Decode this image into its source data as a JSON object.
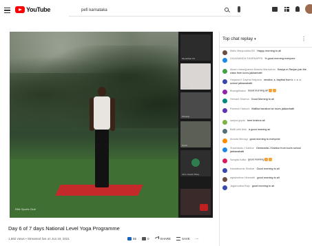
{
  "header": {
    "logo_text": "YouTube",
    "search_value": "pefi karnataka"
  },
  "video": {
    "speaker_name": "Elite Sports Club",
    "tiles": [
      "Muralidhar KS",
      "Nandini",
      "Shivaraj",
      "Mythri",
      "John Joseph Rhea",
      ""
    ]
  },
  "title": "Day 6 of 7 days National Level Yoga Programme",
  "meta": "1,682 views • Streamed live on Jun 19, 2021",
  "actions": {
    "likes": "55",
    "dislikes": "0",
    "share": "SHARE",
    "save": "SAVE",
    "more": "..."
  },
  "chat": {
    "header": "Top chat replay",
    "messages": [
      {
        "author": "Mallu Manjunatha BS",
        "text": "Happy morning to all",
        "color": "#6d4c41"
      },
      {
        "author": "GAJANANDA SHARNAPPA",
        "text": "% good morning everyone",
        "color": "#1e88e5"
      },
      {
        "author": "Akash maranjpanse Akasha Marewiran",
        "text": "Kaviya m Ranjan join the class from kcvrs jakkanhatti",
        "color": "#43a047"
      },
      {
        "author": "Halpana K Dayhal Halpana",
        "text": "nendha. s. baythal from k. r. c. c. school jakkanahatti",
        "color": "#3949ab"
      },
      {
        "author": "Bhangithlakoi",
        "text": "Good morning all",
        "color": "#8e24aa",
        "emoji": true
      },
      {
        "author": "Hemant Sharma",
        "text": "Good Morning to all",
        "color": "#00897b"
      },
      {
        "author": "Ramesh Harkuni",
        "text": "Mallika harakuni sir kcvrs jakkanhatti",
        "color": "#5e35b1"
      },
      {
        "author": "sanjna gupta",
        "text": "here krishna all",
        "color": "#7cb342"
      },
      {
        "author": "Bellil with Alok",
        "text": "a good morning sir",
        "color": "#546e7a"
      },
      {
        "author": "Amoda Mhnagi",
        "text": "good morning to everyone",
        "color": "#fb8c00"
      },
      {
        "author": "Shashikala J Kabbur",
        "text": "Geeksmita J Kabbur from kcvrs school jakkanahatti",
        "color": "#1e88e5"
      },
      {
        "author": "Sangita Kalila",
        "text": "good morning",
        "color": "#d81b60",
        "emoji": true
      },
      {
        "author": "Nandakumar Sirsikar",
        "text": "Good morning to all",
        "color": "#3949ab"
      },
      {
        "author": "rajashekhar Hiremath",
        "text": "good morning to all",
        "color": "#6d4c41"
      },
      {
        "author": "Jagannatha Raju",
        "text": "good morning to all",
        "color": "#3949ab"
      }
    ]
  }
}
